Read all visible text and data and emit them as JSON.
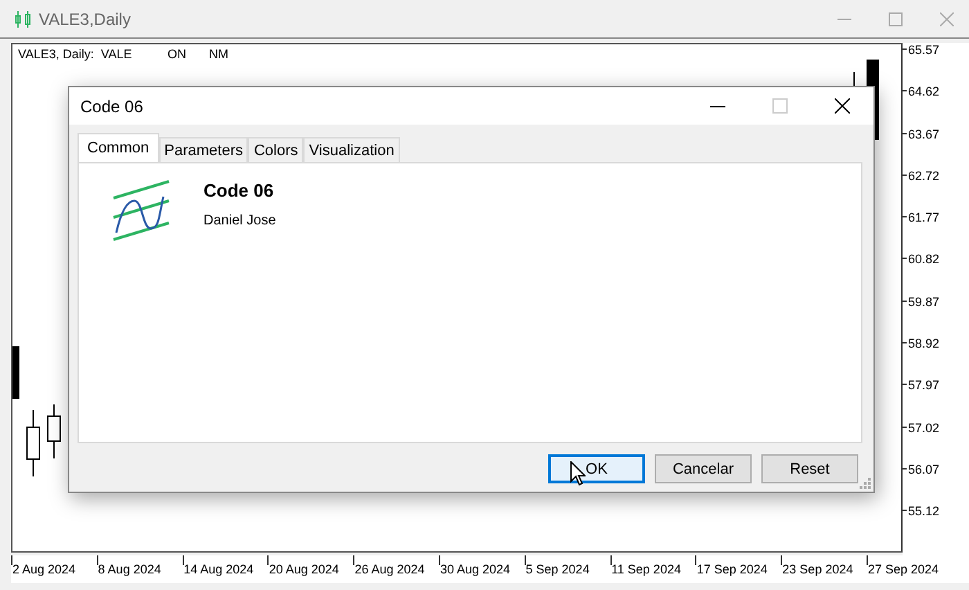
{
  "window": {
    "title": "VALE3,Daily"
  },
  "chart": {
    "legend": [
      "VALE3, Daily:  VALE",
      "ON",
      "NM"
    ],
    "price_labels": [
      "65.57",
      "64.62",
      "63.67",
      "62.72",
      "61.77",
      "60.82",
      "59.87",
      "58.92",
      "57.97",
      "57.02",
      "56.07",
      "55.12"
    ],
    "date_labels": [
      "2 Aug 2024",
      "8 Aug 2024",
      "14 Aug 2024",
      "20 Aug 2024",
      "26 Aug 2024",
      "30 Aug 2024",
      "5 Sep 2024",
      "11 Sep 2024",
      "17 Sep 2024",
      "23 Sep 2024",
      "27 Sep 2024"
    ]
  },
  "dialog": {
    "title": "Code 06",
    "tabs": [
      {
        "label": "Common",
        "selected": true
      },
      {
        "label": "Parameters",
        "selected": false
      },
      {
        "label": "Colors",
        "selected": false
      },
      {
        "label": "Visualization",
        "selected": false
      }
    ],
    "program_name": "Code 06",
    "author": "Daniel Jose",
    "buttons": [
      {
        "label": "OK",
        "default": true
      },
      {
        "label": "Cancelar",
        "default": false
      },
      {
        "label": "Reset",
        "default": false
      }
    ]
  }
}
